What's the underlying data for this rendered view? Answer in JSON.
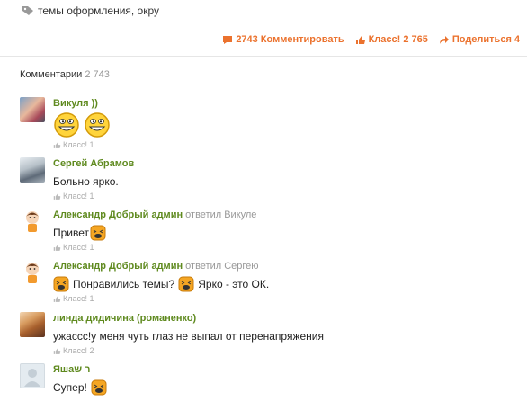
{
  "topic": {
    "tags_text": "темы оформления, окру"
  },
  "actions": {
    "comments_count": "2743",
    "comments_label": "Комментировать",
    "class_label": "Класс!",
    "class_count": "2 765",
    "share_label": "Поделиться",
    "share_count": "4"
  },
  "comments_header": {
    "label": "Комментарии",
    "count": "2 743"
  },
  "comments": [
    {
      "author": "Викуля ))",
      "reply_to": "",
      "text": "",
      "likes": "Класс! 1"
    },
    {
      "author": "Сергей Абрамов",
      "reply_to": "",
      "text": "Больно ярко.",
      "likes": "Класс! 1"
    },
    {
      "author": "Александр Добрый админ",
      "reply_to": "ответил Викуле",
      "text": "Привет",
      "likes": "Класс! 1"
    },
    {
      "author": "Александр Добрый админ",
      "reply_to": "ответил Сергею",
      "text_a": "Понравились темы?",
      "text_b": "Ярко - это ОК.",
      "likes": "Класс! 1"
    },
    {
      "author": "линда дидичина (романенко)",
      "reply_to": "",
      "text": "ужасcс!у меня чуть глаз не выпал от перенапряжения",
      "likes": "Класс! 2"
    },
    {
      "author": "Яшаר ש",
      "reply_to": "",
      "text": "Супер!",
      "likes": ""
    }
  ],
  "colors": {
    "accent": "#eb722e",
    "author": "#5f8a1f"
  }
}
